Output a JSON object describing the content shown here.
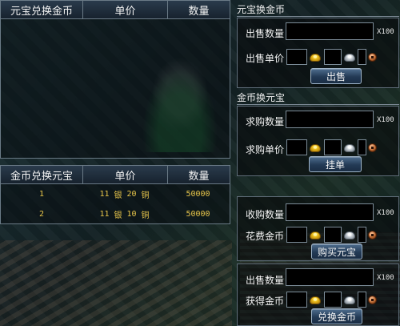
{
  "top_table": {
    "headers": [
      "元宝兑换金币",
      "单价",
      "数量"
    ],
    "rows": []
  },
  "bottom_table": {
    "headers": [
      "金币兑换元宝",
      "单价",
      "数量"
    ],
    "rows": [
      {
        "index": "1",
        "gold": "11",
        "gold_unit": "银",
        "silver": "20",
        "silver_unit": "铜",
        "quantity": "50000"
      },
      {
        "index": "2",
        "gold": "11",
        "gold_unit": "银",
        "silver": "10",
        "silver_unit": "铜",
        "quantity": "50000"
      }
    ]
  },
  "sell_ingot": {
    "title": "元宝换金币",
    "qty_label": "出售数量",
    "qty_unit": "X100",
    "price_label": "出售单价",
    "button": "出售"
  },
  "buy_ingot": {
    "title": "金币换元宝",
    "qty_label": "求购数量",
    "qty_unit": "X100",
    "price_label": "求购单价",
    "button": "挂单"
  },
  "purchase_ingot": {
    "qty_label": "收购数量",
    "qty_unit": "X100",
    "cost_label": "花费金币",
    "button": "购买元宝"
  },
  "exchange_gold": {
    "qty_label": "出售数量",
    "qty_unit": "X100",
    "gain_label": "获得金币",
    "button": "兑换金币"
  },
  "icons": [
    "gold-ingot-icon",
    "silver-ingot-icon",
    "copper-coin-icon"
  ],
  "colors": {
    "header_bg": "#2a3b4c",
    "row_text": "#e7c54a",
    "button": "#2c4866",
    "border": "#6a7a86"
  }
}
